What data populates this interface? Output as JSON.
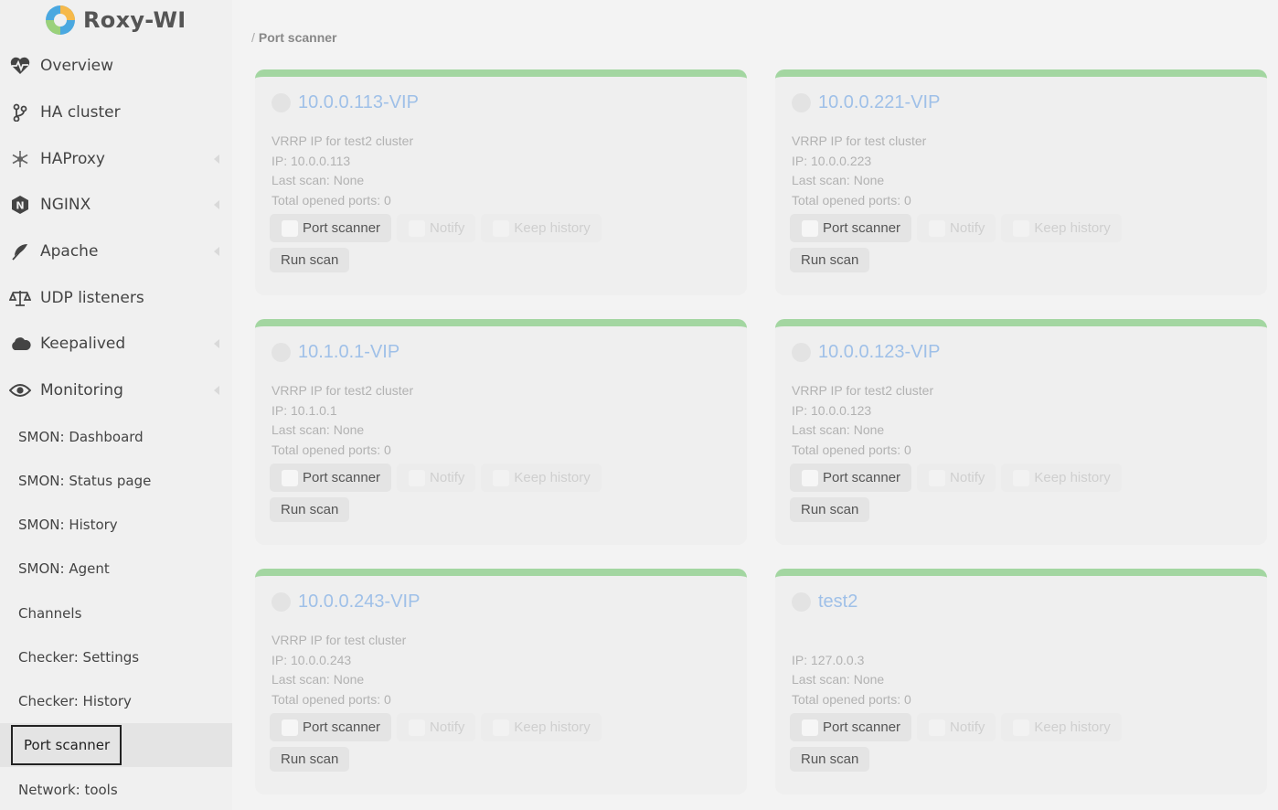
{
  "app": {
    "name": "Roxy-WI"
  },
  "sidebar": {
    "items": [
      {
        "label": "Overview",
        "icon": "heartbeat-icon"
      },
      {
        "label": "HA cluster",
        "icon": "branch-icon"
      },
      {
        "label": "HAProxy",
        "icon": "snowflake-icon"
      },
      {
        "label": "NGINX",
        "icon": "nginx-icon"
      },
      {
        "label": "Apache",
        "icon": "feather-icon"
      },
      {
        "label": "UDP listeners",
        "icon": "balance-scale-icon"
      },
      {
        "label": "Keepalived",
        "icon": "cloud-icon"
      },
      {
        "label": "Monitoring",
        "icon": "eye-icon"
      }
    ],
    "subitems": [
      "SMON: Dashboard",
      "SMON: Status page",
      "SMON: History",
      "SMON: Agent",
      "Channels",
      "Checker: Settings",
      "Checker: History",
      "Port scanner",
      "Network: tools"
    ],
    "active_subitem": "Port scanner"
  },
  "breadcrumb": {
    "separator": "/",
    "current": "Port scanner"
  },
  "labels": {
    "port_scanner": "Port scanner",
    "notify": "Notify",
    "keep_history": "Keep history",
    "run_scan": "Run scan"
  },
  "cards": [
    {
      "title": "10.0.0.113-VIP",
      "desc": "VRRP IP for test2 cluster",
      "ip": "IP: 10.0.0.113",
      "last_scan": "Last scan: None",
      "total_ports": "Total opened ports: 0"
    },
    {
      "title": "10.0.0.221-VIP",
      "desc": "VRRP IP for test cluster",
      "ip": "IP: 10.0.0.223",
      "last_scan": "Last scan: None",
      "total_ports": "Total opened ports: 0"
    },
    {
      "title": "10.1.0.1-VIP",
      "desc": "VRRP IP for test2 cluster",
      "ip": "IP: 10.1.0.1",
      "last_scan": "Last scan: None",
      "total_ports": "Total opened ports: 0"
    },
    {
      "title": "10.0.0.123-VIP",
      "desc": "VRRP IP for test2 cluster",
      "ip": "IP: 10.0.0.123",
      "last_scan": "Last scan: None",
      "total_ports": "Total opened ports: 0"
    },
    {
      "title": "10.0.0.243-VIP",
      "desc": "VRRP IP for test cluster",
      "ip": "IP: 10.0.0.243",
      "last_scan": "Last scan: None",
      "total_ports": "Total opened ports: 0"
    },
    {
      "title": "test2",
      "desc": "",
      "ip": "IP: 127.0.0.3",
      "last_scan": "Last scan: None",
      "total_ports": "Total opened ports: 0"
    }
  ],
  "colors": {
    "card_accent": "#a3d6a1",
    "title_link": "#9fc0e8",
    "active_border": "#222222"
  }
}
